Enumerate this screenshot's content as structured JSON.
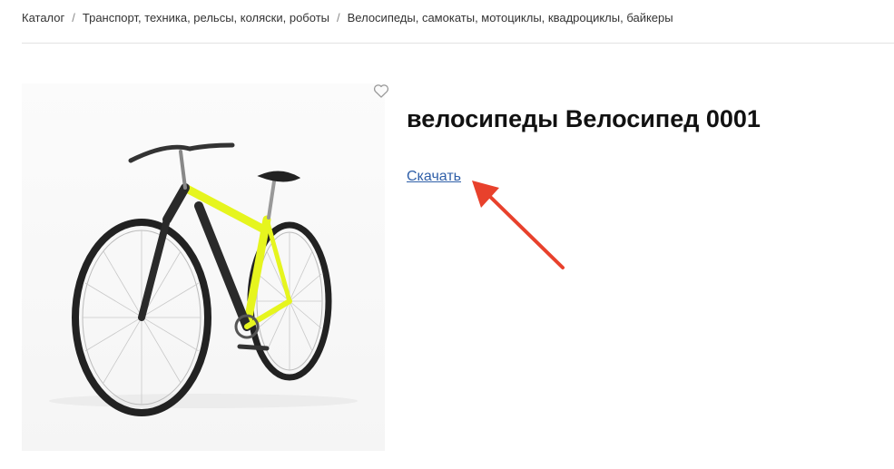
{
  "breadcrumb": [
    "Каталог",
    "Транспорт, техника, рельсы, коляски, роботы",
    "Велосипеды, самокаты, мотоциклы, квадроциклы, байкеры"
  ],
  "breadcrumb_separator": "/",
  "product": {
    "title": "велосипеды Велосипед 0001",
    "download_label": "Скачать",
    "image_icon": "bicycle-image",
    "favorite_icon": "heart-icon"
  },
  "colors": {
    "link": "#2f5fa8",
    "frame": "#e6f51e",
    "annotation_arrow": "#e8412c"
  }
}
